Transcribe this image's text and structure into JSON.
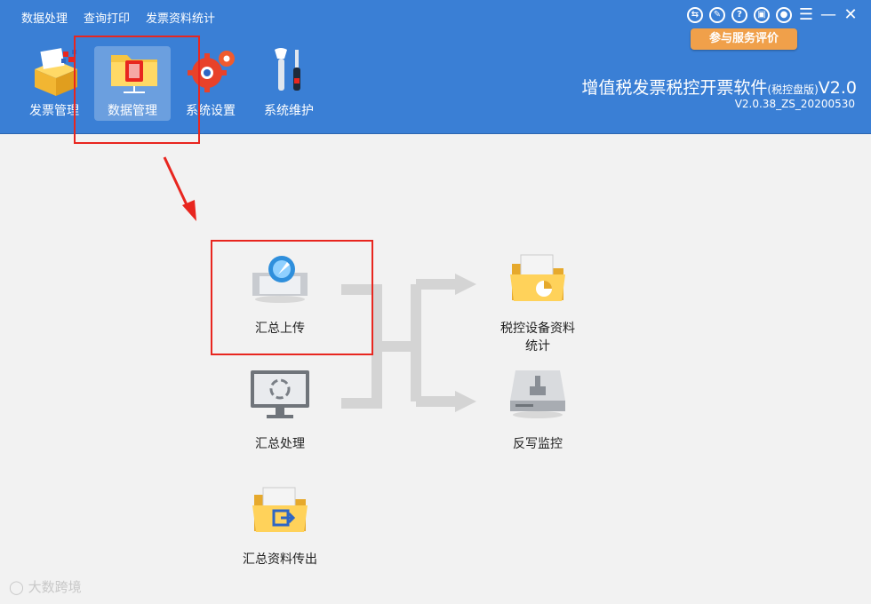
{
  "menu": {
    "items": [
      "数据处理",
      "查询打印",
      "发票资料统计"
    ]
  },
  "window_icons": [
    "switch-icon",
    "feedback-icon",
    "help-icon",
    "lock-icon",
    "user-icon",
    "menu-icon",
    "minimize-icon",
    "close-icon"
  ],
  "rate_button": "参与服务评价",
  "toolbar": [
    {
      "label": "发票管理",
      "icon": "invoice-box-icon"
    },
    {
      "label": "数据管理",
      "icon": "data-folder-icon",
      "active": true
    },
    {
      "label": "系统设置",
      "icon": "gear-icon"
    },
    {
      "label": "系统维护",
      "icon": "wrench-screwdriver-icon"
    }
  ],
  "app": {
    "title": "增值税发票税控开票软件",
    "edition": "(税控盘版)",
    "title_version": "V2.0",
    "version": "V2.0.38_ZS_20200530"
  },
  "features": {
    "upload": {
      "label": "汇总上传",
      "icon": "upload-globe-icon"
    },
    "process": {
      "label": "汇总处理",
      "icon": "monitor-refresh-icon"
    },
    "export": {
      "label": "汇总资料传出",
      "icon": "folder-export-icon"
    },
    "stats_line1": "税控设备资料",
    "stats_line2": "统计",
    "stats_icon": "folder-chart-icon",
    "writeback": {
      "label": "反写监控",
      "icon": "drive-brush-icon"
    }
  },
  "watermark": "大数跨境",
  "colors": {
    "header": "#3a7fd5",
    "highlight": "#e8261f",
    "rate_button": "#f0a04a"
  }
}
